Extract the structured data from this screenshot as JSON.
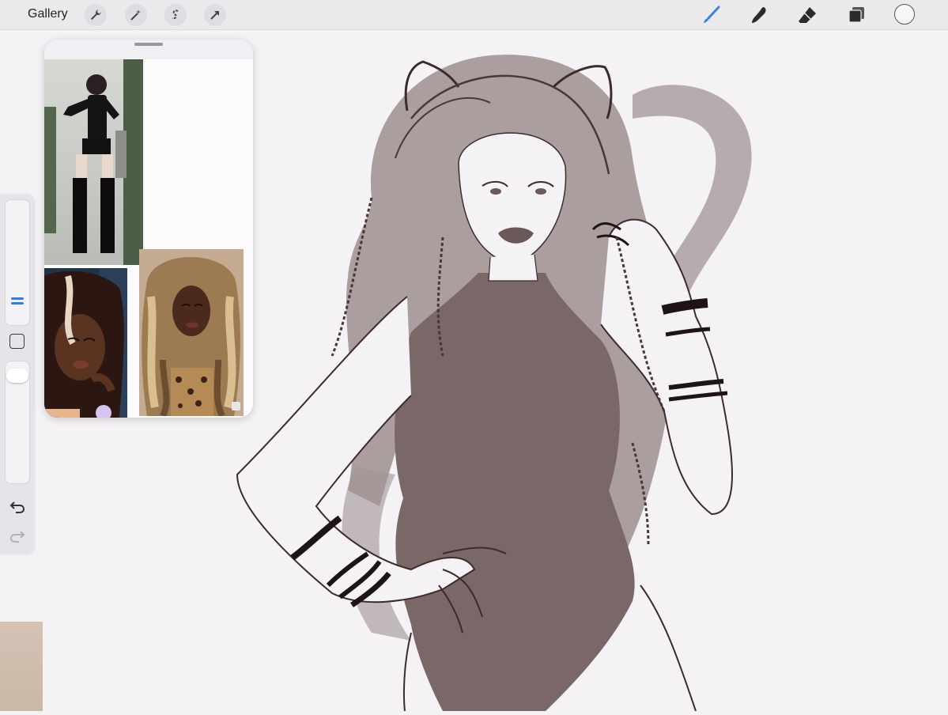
{
  "toolbar": {
    "gallery_label": "Gallery",
    "left_tools": [
      "wrench-icon",
      "magic-wand-icon",
      "selection-s-icon",
      "transform-arrow-icon"
    ],
    "right_tools": [
      "brush-icon",
      "smudge-icon",
      "eraser-icon",
      "layers-icon"
    ],
    "active_tool": "brush-icon",
    "active_color": "#3b82e0",
    "current_color": "#f7f7f7"
  },
  "sidebar": {
    "brush_size_level": 0.33,
    "opacity_level": 0.95,
    "controls": [
      "brush-size-slider",
      "modify-button",
      "opacity-slider",
      "undo-icon",
      "redo-icon"
    ]
  },
  "reference_panel": {
    "images": [
      "gothic-outfit-photo",
      "braided-hair-portrait",
      "curly-blonde-hair-photo"
    ]
  },
  "colors": {
    "toolbar_bg": "#ebe9ec",
    "canvas_bg": "#f4f2f4",
    "sketch_line": "#3d2b2c",
    "sketch_fill": "#7a6868",
    "hair_fill": "#a39595",
    "tail_fill": "#aaa0a2"
  }
}
